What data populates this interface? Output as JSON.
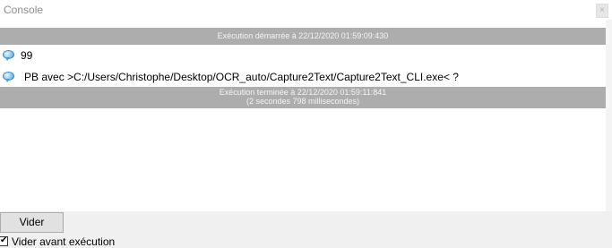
{
  "window": {
    "title": "Console",
    "close_glyph": "×"
  },
  "console": {
    "start_banner": "Exécution démarrée à 22/12/2020 01:59:09:430",
    "lines": [
      {
        "icon": "speech-bubble-icon",
        "text": "99"
      },
      {
        "icon": "speech-bubble-icon",
        "text": "PB avec >C:/Users/Christophe/Desktop/OCR_auto/Capture2Text/Capture2Text_CLI.exe< ?"
      }
    ],
    "end_banner_line1": "Exécution terminée à 22/12/2020 01:59:11:841",
    "end_banner_line2": "(2 secondes 798 millisecondes)"
  },
  "footer": {
    "clear_button_label": "Vider",
    "clear_before_run_label": "Vider avant exécution",
    "clear_before_run_checked": true,
    "check_glyph": "✔"
  },
  "colors": {
    "banner_bg": "#adadad",
    "banner_text": "#f5f5f5",
    "panel_bg": "#f0f0f0",
    "title_text": "#8c8c8c"
  }
}
